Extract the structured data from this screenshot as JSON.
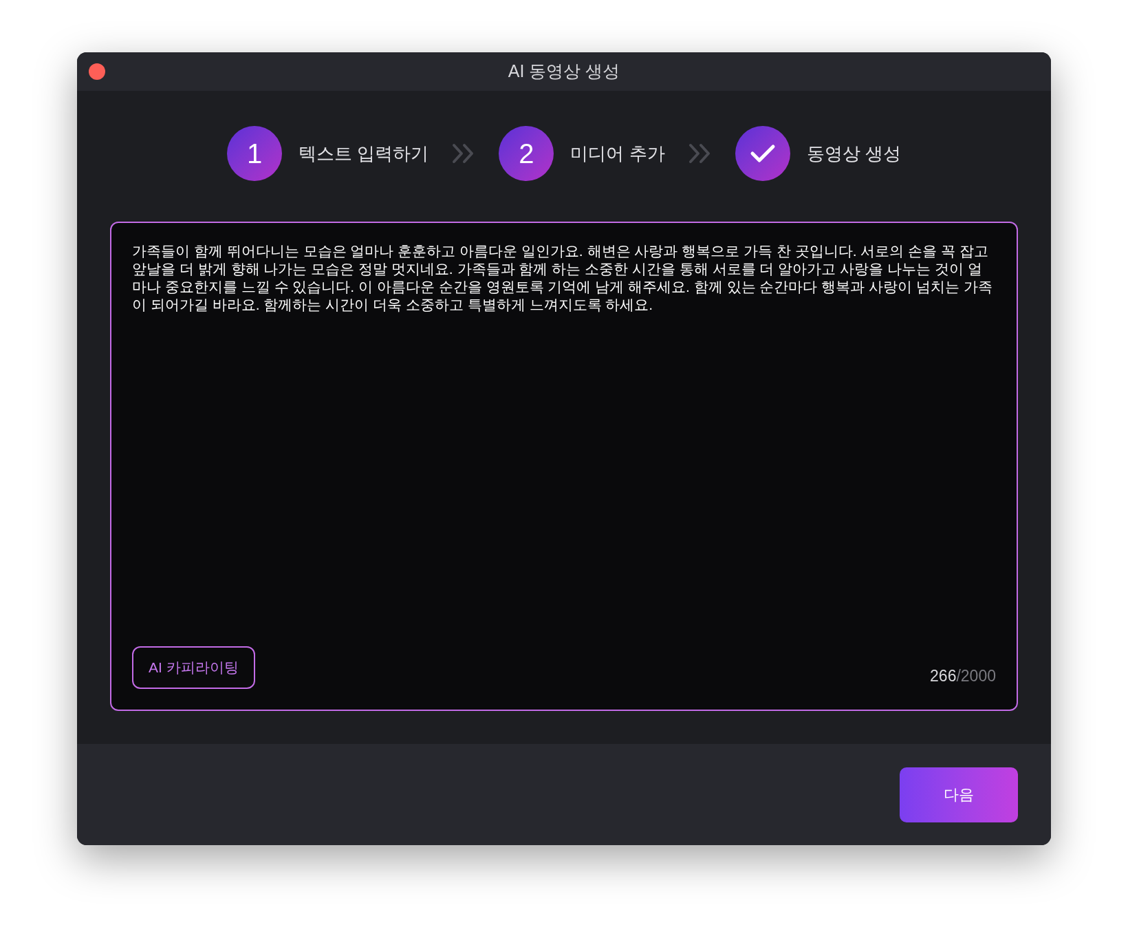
{
  "window": {
    "title": "AI 동영상 생성"
  },
  "steps": [
    {
      "kind": "number",
      "badge": "1",
      "label": "텍스트 입력하기"
    },
    {
      "kind": "number",
      "badge": "2",
      "label": "미디어 추가"
    },
    {
      "kind": "check",
      "label": "동영상 생성"
    }
  ],
  "editor": {
    "value": "가족들이 함께 뛰어다니는 모습은 얼마나 훈훈하고 아름다운 일인가요. 해변은 사랑과 행복으로 가득 찬 곳입니다. 서로의 손을 꼭 잡고 앞날을 더 밝게 향해 나가는 모습은 정말 멋지네요. 가족들과 함께 하는 소중한 시간을 통해 서로를 더 알아가고 사랑을 나누는 것이 얼마나 중요한지를 느낄 수 있습니다. 이 아름다운 순간을 영원토록 기억에 남게 해주세요. 함께 있는 순간마다 행복과 사랑이 넘치는 가족이 되어가길 바라요. 함께하는 시간이 더욱 소중하고 특별하게 느껴지도록 하세요.",
    "ai_button": "AI 카피라이팅",
    "count": "266",
    "limit": "/2000"
  },
  "next_button": "다음"
}
